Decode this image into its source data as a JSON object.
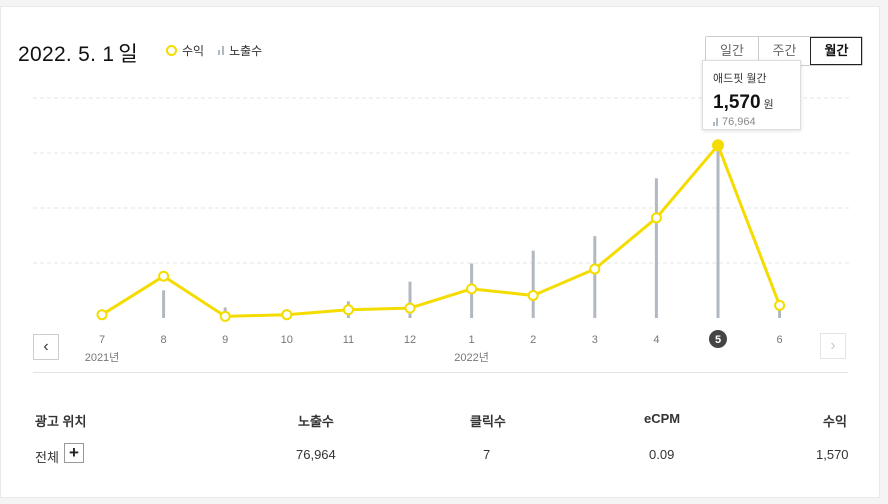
{
  "header": {
    "date": "2022. 5. 1",
    "day_suffix": "일",
    "legend": {
      "revenue": "수익",
      "impressions": "노출수"
    },
    "period_tabs": [
      "일간",
      "주간",
      "월간"
    ],
    "active_tab": "월간"
  },
  "tooltip": {
    "title": "애드핏 월간",
    "value": "1,570",
    "unit": "원",
    "impressions": "76,964"
  },
  "chart_data": {
    "type": "bar+line",
    "categories": [
      "7",
      "8",
      "9",
      "10",
      "11",
      "12",
      "1",
      "2",
      "3",
      "4",
      "5",
      "6"
    ],
    "year_labels": [
      {
        "index": 0,
        "text": "2021년"
      },
      {
        "index": 6,
        "text": "2022년"
      }
    ],
    "selected_index": 10,
    "series": [
      {
        "name": "수익",
        "type": "line",
        "color": "#f5dc00",
        "values": [
          30,
          380,
          15,
          30,
          75,
          90,
          265,
          205,
          445,
          910,
          1570,
          115
        ]
      },
      {
        "name": "노출수",
        "type": "bar",
        "color": "#b1b8c0",
        "values": [
          0,
          12600,
          4800,
          4000,
          7600,
          16500,
          24800,
          30600,
          37200,
          63500,
          76964,
          5000
        ]
      }
    ],
    "grid": true
  },
  "nav": {
    "prev": "‹",
    "next": "›"
  },
  "table": {
    "headers": [
      "광고 위치",
      "노출수",
      "클릭수",
      "eCPM",
      "수익"
    ],
    "row": {
      "label": "전체",
      "impressions": "76,964",
      "clicks": "7",
      "ecpm": "0.09",
      "revenue": "1,570"
    },
    "expand": "+"
  }
}
